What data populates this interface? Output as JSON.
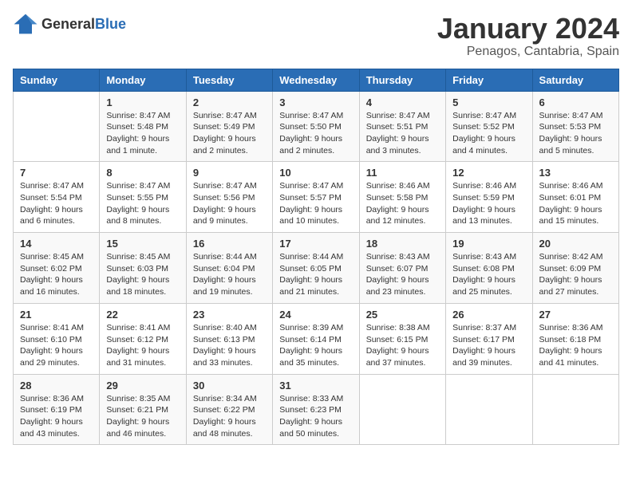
{
  "logo": {
    "text_general": "General",
    "text_blue": "Blue"
  },
  "header": {
    "month": "January 2024",
    "location": "Penagos, Cantabria, Spain"
  },
  "weekdays": [
    "Sunday",
    "Monday",
    "Tuesday",
    "Wednesday",
    "Thursday",
    "Friday",
    "Saturday"
  ],
  "weeks": [
    [
      {
        "day": "",
        "sunrise": "",
        "sunset": "",
        "daylight": ""
      },
      {
        "day": "1",
        "sunrise": "Sunrise: 8:47 AM",
        "sunset": "Sunset: 5:48 PM",
        "daylight": "Daylight: 9 hours and 1 minute."
      },
      {
        "day": "2",
        "sunrise": "Sunrise: 8:47 AM",
        "sunset": "Sunset: 5:49 PM",
        "daylight": "Daylight: 9 hours and 2 minutes."
      },
      {
        "day": "3",
        "sunrise": "Sunrise: 8:47 AM",
        "sunset": "Sunset: 5:50 PM",
        "daylight": "Daylight: 9 hours and 2 minutes."
      },
      {
        "day": "4",
        "sunrise": "Sunrise: 8:47 AM",
        "sunset": "Sunset: 5:51 PM",
        "daylight": "Daylight: 9 hours and 3 minutes."
      },
      {
        "day": "5",
        "sunrise": "Sunrise: 8:47 AM",
        "sunset": "Sunset: 5:52 PM",
        "daylight": "Daylight: 9 hours and 4 minutes."
      },
      {
        "day": "6",
        "sunrise": "Sunrise: 8:47 AM",
        "sunset": "Sunset: 5:53 PM",
        "daylight": "Daylight: 9 hours and 5 minutes."
      }
    ],
    [
      {
        "day": "7",
        "sunrise": "Sunrise: 8:47 AM",
        "sunset": "Sunset: 5:54 PM",
        "daylight": "Daylight: 9 hours and 6 minutes."
      },
      {
        "day": "8",
        "sunrise": "Sunrise: 8:47 AM",
        "sunset": "Sunset: 5:55 PM",
        "daylight": "Daylight: 9 hours and 8 minutes."
      },
      {
        "day": "9",
        "sunrise": "Sunrise: 8:47 AM",
        "sunset": "Sunset: 5:56 PM",
        "daylight": "Daylight: 9 hours and 9 minutes."
      },
      {
        "day": "10",
        "sunrise": "Sunrise: 8:47 AM",
        "sunset": "Sunset: 5:57 PM",
        "daylight": "Daylight: 9 hours and 10 minutes."
      },
      {
        "day": "11",
        "sunrise": "Sunrise: 8:46 AM",
        "sunset": "Sunset: 5:58 PM",
        "daylight": "Daylight: 9 hours and 12 minutes."
      },
      {
        "day": "12",
        "sunrise": "Sunrise: 8:46 AM",
        "sunset": "Sunset: 5:59 PM",
        "daylight": "Daylight: 9 hours and 13 minutes."
      },
      {
        "day": "13",
        "sunrise": "Sunrise: 8:46 AM",
        "sunset": "Sunset: 6:01 PM",
        "daylight": "Daylight: 9 hours and 15 minutes."
      }
    ],
    [
      {
        "day": "14",
        "sunrise": "Sunrise: 8:45 AM",
        "sunset": "Sunset: 6:02 PM",
        "daylight": "Daylight: 9 hours and 16 minutes."
      },
      {
        "day": "15",
        "sunrise": "Sunrise: 8:45 AM",
        "sunset": "Sunset: 6:03 PM",
        "daylight": "Daylight: 9 hours and 18 minutes."
      },
      {
        "day": "16",
        "sunrise": "Sunrise: 8:44 AM",
        "sunset": "Sunset: 6:04 PM",
        "daylight": "Daylight: 9 hours and 19 minutes."
      },
      {
        "day": "17",
        "sunrise": "Sunrise: 8:44 AM",
        "sunset": "Sunset: 6:05 PM",
        "daylight": "Daylight: 9 hours and 21 minutes."
      },
      {
        "day": "18",
        "sunrise": "Sunrise: 8:43 AM",
        "sunset": "Sunset: 6:07 PM",
        "daylight": "Daylight: 9 hours and 23 minutes."
      },
      {
        "day": "19",
        "sunrise": "Sunrise: 8:43 AM",
        "sunset": "Sunset: 6:08 PM",
        "daylight": "Daylight: 9 hours and 25 minutes."
      },
      {
        "day": "20",
        "sunrise": "Sunrise: 8:42 AM",
        "sunset": "Sunset: 6:09 PM",
        "daylight": "Daylight: 9 hours and 27 minutes."
      }
    ],
    [
      {
        "day": "21",
        "sunrise": "Sunrise: 8:41 AM",
        "sunset": "Sunset: 6:10 PM",
        "daylight": "Daylight: 9 hours and 29 minutes."
      },
      {
        "day": "22",
        "sunrise": "Sunrise: 8:41 AM",
        "sunset": "Sunset: 6:12 PM",
        "daylight": "Daylight: 9 hours and 31 minutes."
      },
      {
        "day": "23",
        "sunrise": "Sunrise: 8:40 AM",
        "sunset": "Sunset: 6:13 PM",
        "daylight": "Daylight: 9 hours and 33 minutes."
      },
      {
        "day": "24",
        "sunrise": "Sunrise: 8:39 AM",
        "sunset": "Sunset: 6:14 PM",
        "daylight": "Daylight: 9 hours and 35 minutes."
      },
      {
        "day": "25",
        "sunrise": "Sunrise: 8:38 AM",
        "sunset": "Sunset: 6:15 PM",
        "daylight": "Daylight: 9 hours and 37 minutes."
      },
      {
        "day": "26",
        "sunrise": "Sunrise: 8:37 AM",
        "sunset": "Sunset: 6:17 PM",
        "daylight": "Daylight: 9 hours and 39 minutes."
      },
      {
        "day": "27",
        "sunrise": "Sunrise: 8:36 AM",
        "sunset": "Sunset: 6:18 PM",
        "daylight": "Daylight: 9 hours and 41 minutes."
      }
    ],
    [
      {
        "day": "28",
        "sunrise": "Sunrise: 8:36 AM",
        "sunset": "Sunset: 6:19 PM",
        "daylight": "Daylight: 9 hours and 43 minutes."
      },
      {
        "day": "29",
        "sunrise": "Sunrise: 8:35 AM",
        "sunset": "Sunset: 6:21 PM",
        "daylight": "Daylight: 9 hours and 46 minutes."
      },
      {
        "day": "30",
        "sunrise": "Sunrise: 8:34 AM",
        "sunset": "Sunset: 6:22 PM",
        "daylight": "Daylight: 9 hours and 48 minutes."
      },
      {
        "day": "31",
        "sunrise": "Sunrise: 8:33 AM",
        "sunset": "Sunset: 6:23 PM",
        "daylight": "Daylight: 9 hours and 50 minutes."
      },
      {
        "day": "",
        "sunrise": "",
        "sunset": "",
        "daylight": ""
      },
      {
        "day": "",
        "sunrise": "",
        "sunset": "",
        "daylight": ""
      },
      {
        "day": "",
        "sunrise": "",
        "sunset": "",
        "daylight": ""
      }
    ]
  ]
}
